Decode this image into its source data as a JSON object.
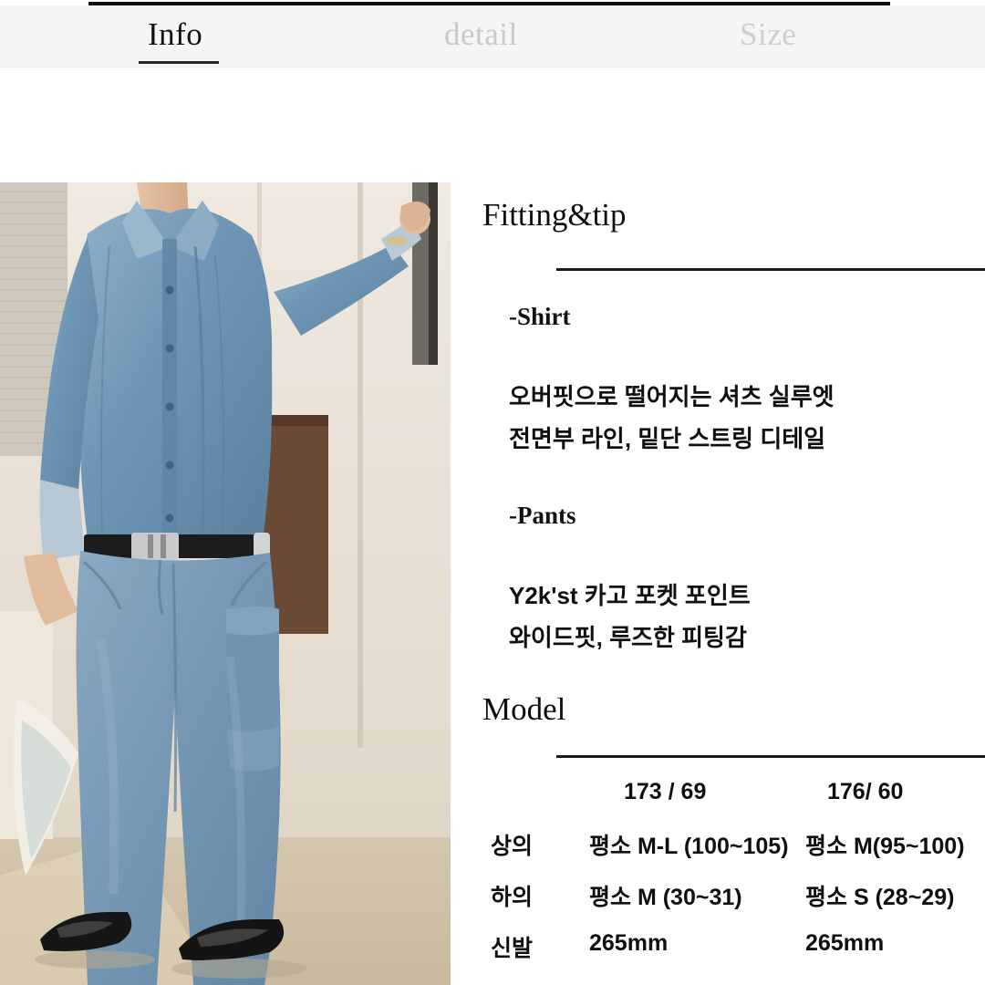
{
  "tabs": [
    {
      "label": "Info",
      "active": true
    },
    {
      "label": "detail",
      "active": false
    },
    {
      "label": "Size",
      "active": false
    }
  ],
  "photo": {
    "alt": "model-wearing-denim-shirt-and-wide-cargo-jeans",
    "description": "Full body photo of a model in an oversized light-blue denim shirt, black belt, wide-fit blue cargo jeans and black square-toe leather shoes, standing indoors."
  },
  "fitting": {
    "heading": "Fitting&tip",
    "shirt_label": "-Shirt",
    "shirt_line1": "오버핏으로 떨어지는 셔츠 실루엣",
    "shirt_line2": "전면부 라인, 밑단 스트링 디테일",
    "pants_label": "-Pants",
    "pants_line1": "Y2k'st 카고 포켓 포인트",
    "pants_line2": "와이드핏, 루즈한 피팅감"
  },
  "model": {
    "heading": "Model",
    "columns": [
      "173 / 69",
      "176/ 60"
    ],
    "rows": [
      {
        "label": "상의",
        "v1": "평소 M-L (100~105)",
        "v2": "평소 M(95~100)"
      },
      {
        "label": "하의",
        "v1": "평소 M (30~31)",
        "v2": "평소 S (28~29)"
      },
      {
        "label": "신발",
        "v1": "265mm",
        "v2": "265mm"
      }
    ]
  },
  "colors": {
    "text": "#101010",
    "muted": "#c9c9c9",
    "rule": "#1a1a1a",
    "tabbar_bg": "#f5f5f5"
  }
}
